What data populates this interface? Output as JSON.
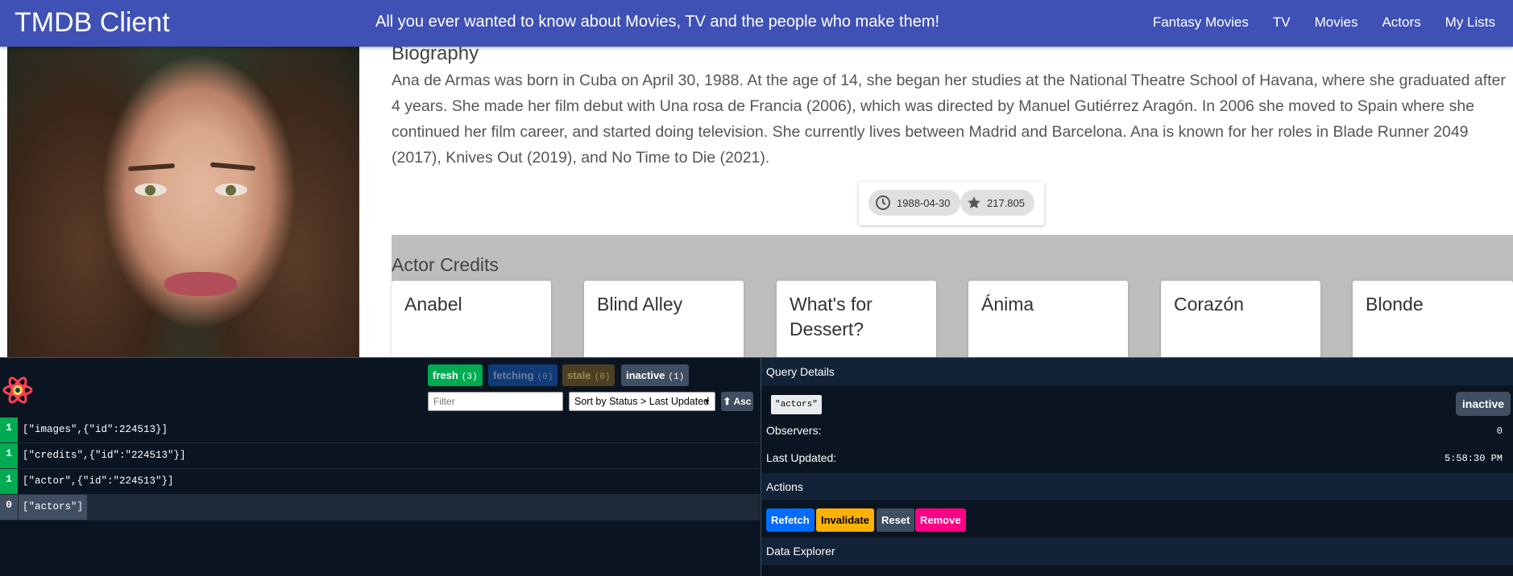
{
  "app": {
    "title": "TMDB Client",
    "tagline": "All you ever wanted to know about Movies, TV and the people who make them!",
    "nav": [
      "Fantasy Movies",
      "TV",
      "Movies",
      "Actors",
      "My Lists"
    ],
    "accent_color": "#3f51b5"
  },
  "biography": {
    "heading": "Biography",
    "text": "Ana de Armas was born in Cuba on April 30, 1988. At the age of 14, she began her studies at the National Theatre School of Havana, where she graduated after 4 years. She made her film debut with Una rosa de Francia (2006), which was directed by Manuel Gutiérrez Aragón. In 2006 she moved to Spain where she continued her film career, and started doing television. She currently lives between Madrid and Barcelona. Ana is known for her roles in Blade Runner 2049 (2017), Knives Out (2019), and No Time to Die (2021)."
  },
  "stats": {
    "birthday": "1988-04-30",
    "birthday_icon": "clock-icon",
    "popularity": "217.805",
    "popularity_icon": "star-icon"
  },
  "credits": {
    "heading": "Actor Credits",
    "items": [
      "Anabel",
      "Blind Alley",
      "What's for Dessert?",
      "Ánima",
      "Corazón",
      "Blonde"
    ]
  },
  "devtools": {
    "badges": {
      "fresh": {
        "label": "fresh",
        "count": "(3)",
        "color": "#00ab52"
      },
      "fetching": {
        "label": "fetching",
        "count": "(0)",
        "color": "#006bff"
      },
      "stale": {
        "label": "stale",
        "count": "(0)",
        "color": "#ffb200"
      },
      "inactive": {
        "label": "inactive",
        "count": "(1)",
        "color": "#3f4e60"
      }
    },
    "filter_placeholder": "Filter",
    "sort_value": "Sort by Status > Last Updated",
    "asc_label": "⬆ Asc",
    "queries": [
      {
        "count": "1",
        "key": "[\"images\",{\"id\":224513}]"
      },
      {
        "count": "1",
        "key": "[\"credits\",{\"id\":\"224513\"}]"
      },
      {
        "count": "1",
        "key": "[\"actor\",{\"id\":\"224513\"}]"
      },
      {
        "count": "0",
        "key": "[\"actors\"]"
      }
    ],
    "details": {
      "heading": "Query Details",
      "query_key": "\"actors\"",
      "status": "inactive",
      "observers_label": "Observers:",
      "observers_value": "0",
      "updated_label": "Last Updated:",
      "updated_value": "5:58:30 PM"
    },
    "actions": {
      "heading": "Actions",
      "refetch": "Refetch",
      "invalidate": "Invalidate",
      "reset": "Reset",
      "remove": "Remove"
    },
    "explorer_heading": "Data Explorer"
  }
}
